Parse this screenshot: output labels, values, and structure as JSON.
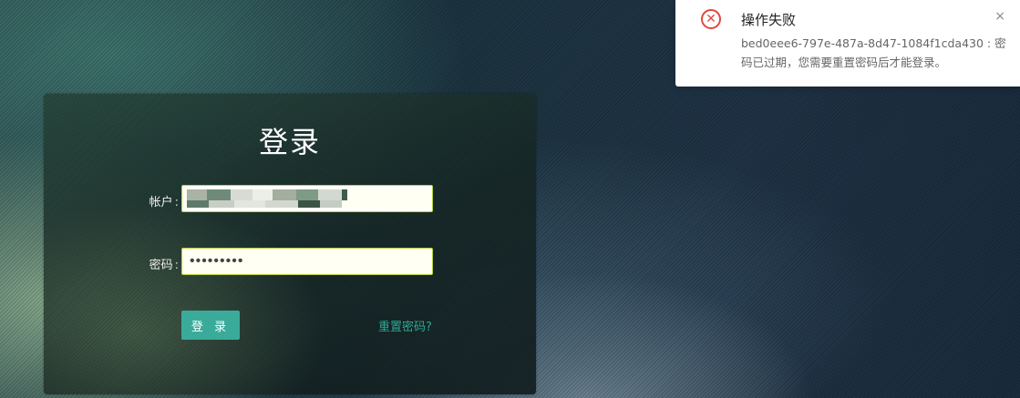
{
  "login": {
    "title": "登录",
    "account_label": "帐户",
    "password_label": "密码",
    "label_separator": ":",
    "password_value": "•••••••••",
    "login_button": "登 录",
    "reset_link": "重置密码?"
  },
  "notification": {
    "title": "操作失败",
    "message": "bed0eee6-797e-487a-8d47-1084f1cda430 : 密码已过期，您需要重置密码后才能登录。",
    "close_label": "×",
    "icon": "error-circle-icon",
    "icon_color": "#e3473c"
  },
  "colors": {
    "accent": "#3aab9b",
    "input_border": "#b6d23c",
    "link": "#2fa893"
  }
}
